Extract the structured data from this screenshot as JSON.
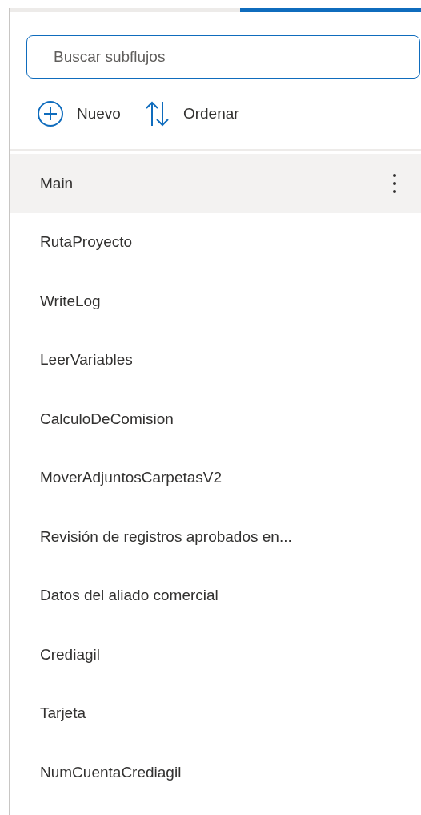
{
  "search": {
    "placeholder": "Buscar subflujos"
  },
  "toolbar": [
    {
      "label": "Nuevo",
      "kind": "add"
    },
    {
      "label": "Ordenar",
      "kind": "sort"
    }
  ],
  "subflows": [
    {
      "name": "Main",
      "selected": true
    },
    {
      "name": "RutaProyecto",
      "selected": false
    },
    {
      "name": "WriteLog",
      "selected": false
    },
    {
      "name": "LeerVariables",
      "selected": false
    },
    {
      "name": "CalculoDeComision",
      "selected": false
    },
    {
      "name": "MoverAdjuntosCarpetasV2",
      "selected": false
    },
    {
      "name": "Revisión de registros aprobados en...",
      "selected": false
    },
    {
      "name": "Datos del aliado comercial",
      "selected": false
    },
    {
      "name": "Crediagil",
      "selected": false
    },
    {
      "name": "Tarjeta",
      "selected": false
    },
    {
      "name": "NumCuentaCrediagil",
      "selected": false
    }
  ]
}
